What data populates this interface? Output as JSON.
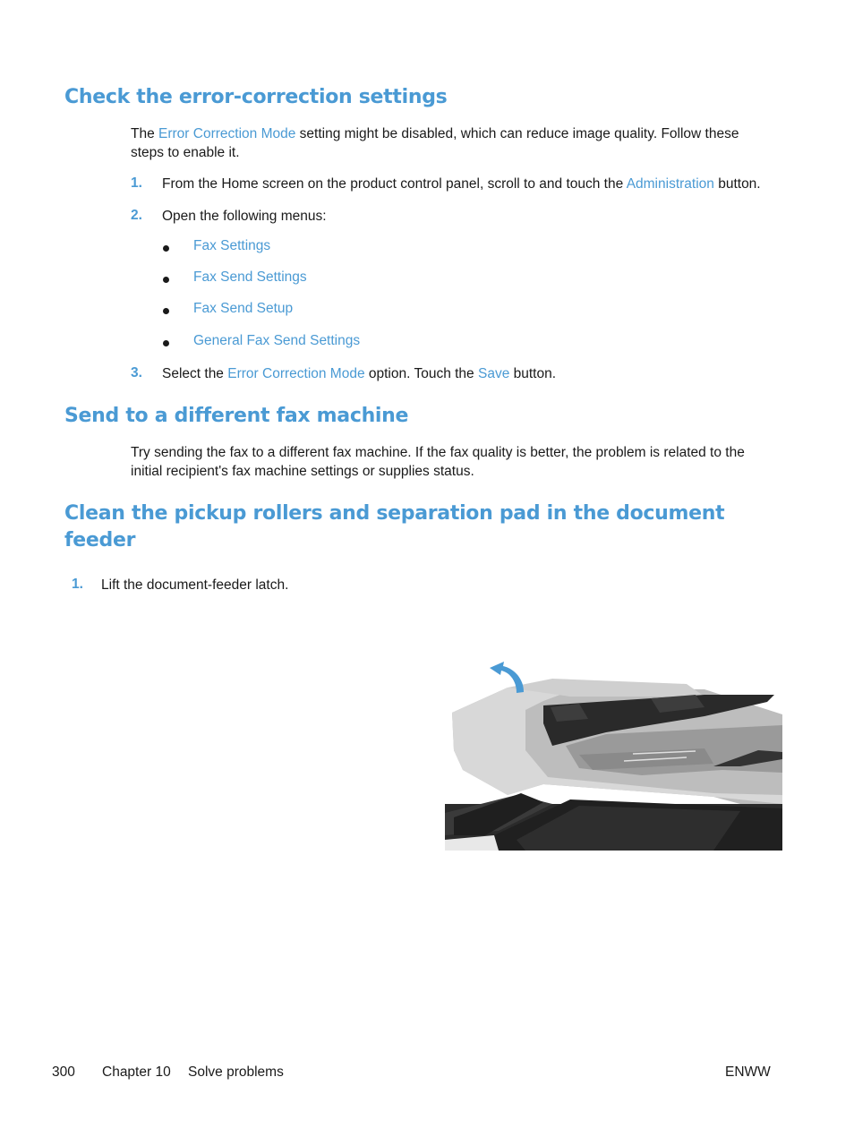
{
  "sections": [
    {
      "heading": "Check the error-correction settings",
      "intro": {
        "pre": "The ",
        "link": "Error Correction Mode",
        "post_line1": " setting might be disabled, which can reduce image quality. Follow these",
        "post_line2": "steps to enable it."
      },
      "steps": [
        {
          "number": "1.",
          "pre": "From the Home screen on the product control panel, scroll to and touch the ",
          "link": "Administration",
          "post": " button."
        },
        {
          "number": "2.",
          "text": "Open the following menus:",
          "menus": [
            "Fax Settings",
            "Fax Send Settings",
            "Fax Send Setup",
            "General Fax Send Settings"
          ]
        },
        {
          "number": "3.",
          "pre": "Select the ",
          "link1": "Error Correction Mode",
          "mid": " option. Touch the ",
          "link2": "Save",
          "post": " button."
        }
      ]
    },
    {
      "heading": "Send to a different fax machine",
      "body_line1": "Try sending the fax to a different fax machine. If the fax quality is better, the problem is related to the",
      "body_line2": "initial recipient's fax machine settings or supplies status."
    },
    {
      "heading_line1": "Clean the pickup rollers and separation pad in the document",
      "heading_line2": "feeder",
      "steps": [
        {
          "number": "1.",
          "text": "Lift the document-feeder latch."
        }
      ],
      "figure": {
        "description": "Printer document feeder with arrow indicating lifting the latch",
        "arrow_color": "#4a9ad4"
      }
    }
  ],
  "footer": {
    "page_number": "300",
    "chapter": "Chapter 10",
    "chapter_title": "Solve problems",
    "locale": "ENWW"
  }
}
